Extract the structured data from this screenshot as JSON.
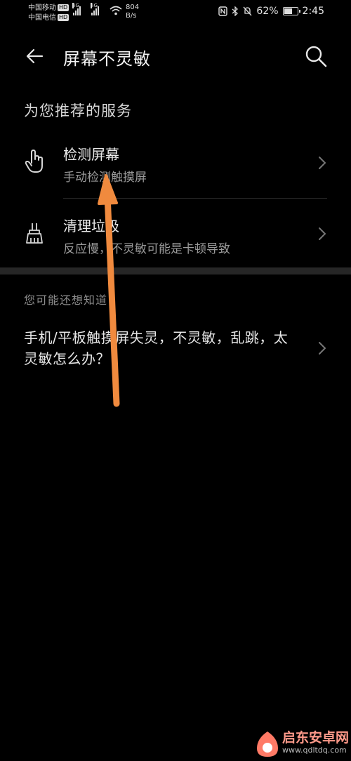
{
  "status": {
    "carrier1": "中国移动",
    "carrier2": "中国电信",
    "hd": "HD",
    "net1": "4G",
    "net2": "4G",
    "speed_value": "804",
    "speed_unit": "B/s",
    "battery": "62%",
    "battery_level": 0.62,
    "time": "2:45"
  },
  "appbar": {
    "title": "屏幕不灵敏",
    "back_icon": "back-arrow-icon",
    "search_icon": "search-icon"
  },
  "recommend": {
    "section_title": "为您推荐的服务",
    "items": [
      {
        "label": "检测屏幕",
        "sub": "手动检测触摸屏",
        "icon": "touch-hand-icon"
      },
      {
        "label": "清理垃圾",
        "sub": "反应慢，不灵敏可能是卡顿导致",
        "icon": "broom-icon"
      }
    ]
  },
  "faq": {
    "section_title": "您可能还想知道",
    "items": [
      {
        "text": "手机/平板触摸屏失灵，不灵敏，乱跳，太灵敏怎么办？"
      }
    ]
  },
  "watermark": {
    "text": "启东安卓网",
    "url": "www.qdltdq.com"
  },
  "colors": {
    "background": "#000000",
    "annotation_arrow": "#f08a3e"
  }
}
